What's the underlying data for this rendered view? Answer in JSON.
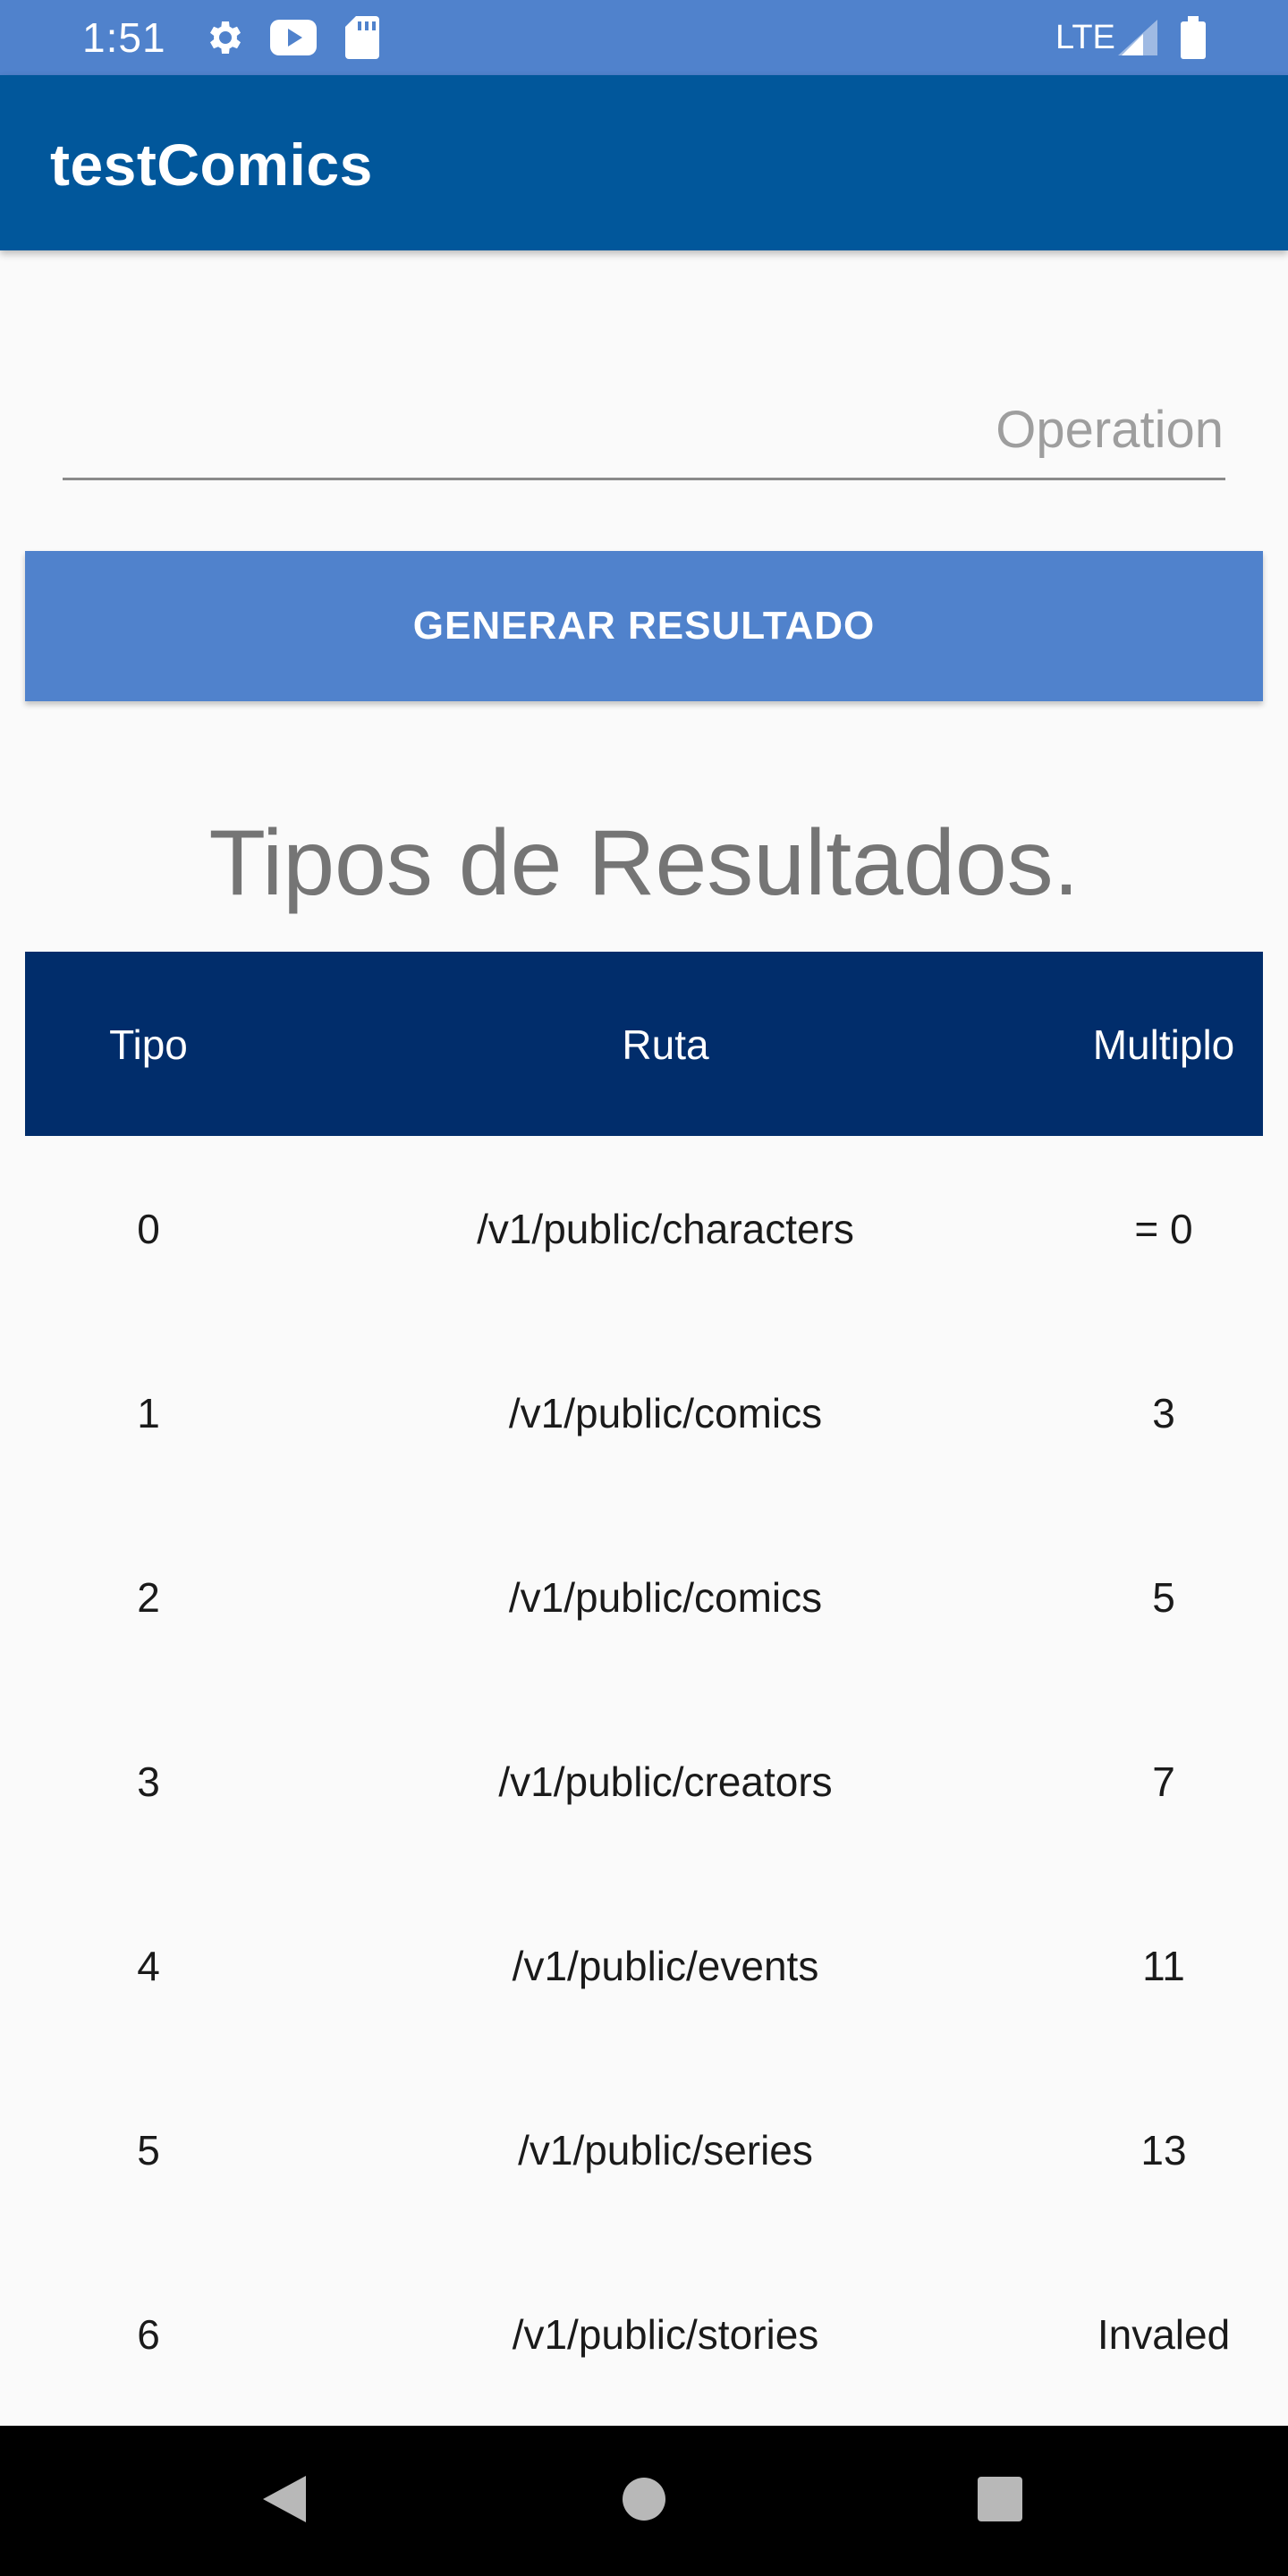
{
  "status_bar": {
    "time": "1:51",
    "network": "LTE",
    "icons": [
      "settings-icon",
      "youtube-icon",
      "sd-card-icon",
      "signal-icon",
      "battery-icon"
    ]
  },
  "app_bar": {
    "title": "testComics"
  },
  "operation_input": {
    "placeholder": "Operation",
    "value": ""
  },
  "generate_button": {
    "label": "GENERAR RESULTADO"
  },
  "results_section": {
    "title": "Tipos de Resultados."
  },
  "table": {
    "headers": {
      "tipo": "Tipo",
      "ruta": "Ruta",
      "multiplo": "Multiplo"
    },
    "rows": [
      {
        "tipo": "0",
        "ruta": "/v1/public/characters",
        "multiplo": "= 0"
      },
      {
        "tipo": "1",
        "ruta": "/v1/public/comics",
        "multiplo": "3"
      },
      {
        "tipo": "2",
        "ruta": "/v1/public/comics",
        "multiplo": "5"
      },
      {
        "tipo": "3",
        "ruta": "/v1/public/creators",
        "multiplo": "7"
      },
      {
        "tipo": "4",
        "ruta": "/v1/public/events",
        "multiplo": "11"
      },
      {
        "tipo": "5",
        "ruta": "/v1/public/series",
        "multiplo": "13"
      },
      {
        "tipo": "6",
        "ruta": "/v1/public/stories",
        "multiplo": "Invaled"
      }
    ]
  },
  "navigation": {
    "icons": [
      "back-icon",
      "home-icon",
      "recents-icon"
    ]
  },
  "colors": {
    "status_bar": "#5082cc",
    "app_bar": "#01579b",
    "button": "#5082cc",
    "table_header": "#012d6b",
    "background": "#fafafa",
    "nav_bar": "#000000"
  }
}
